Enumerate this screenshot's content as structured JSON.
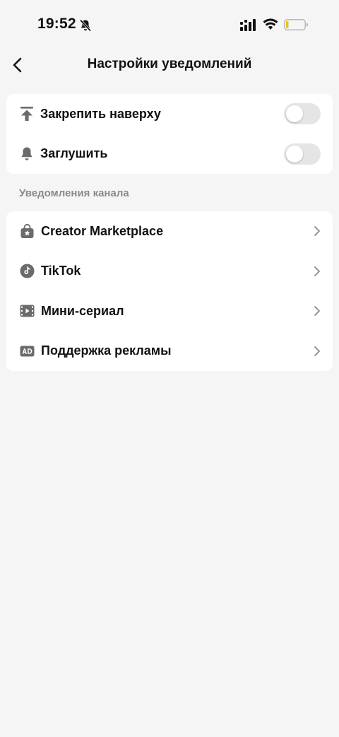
{
  "status_bar": {
    "time": "19:52"
  },
  "header": {
    "title": "Настройки уведомлений"
  },
  "top_settings": [
    {
      "label": "Закрепить наверху",
      "icon": "pin-to-top-icon",
      "toggle_on": false
    },
    {
      "label": "Заглушить",
      "icon": "bell-icon",
      "toggle_on": false
    }
  ],
  "channels_section": {
    "header": "Уведомления канала",
    "items": [
      {
        "label": "Creator Marketplace",
        "icon": "shopping-bag-star-icon"
      },
      {
        "label": "TikTok",
        "icon": "tiktok-icon"
      },
      {
        "label": "Мини-сериал",
        "icon": "film-icon"
      },
      {
        "label": "Поддержка рекламы",
        "icon": "ad-icon"
      }
    ]
  },
  "colors": {
    "background": "#f5f5f5",
    "card": "#ffffff",
    "toggle_off": "#e5e5e5",
    "icon_gray": "#808080",
    "section_header": "#8a8a8a"
  }
}
